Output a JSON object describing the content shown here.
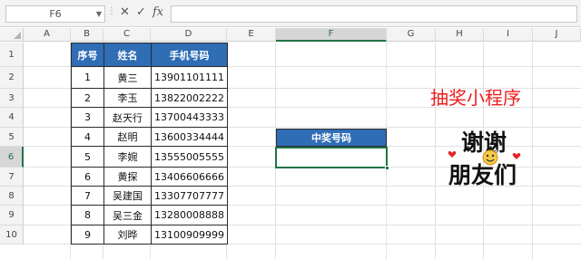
{
  "formula_bar": {
    "name_box": "F6",
    "cancel_icon": "✕",
    "confirm_icon": "✓",
    "fx_label": "fx",
    "formula": ""
  },
  "columns": [
    "A",
    "B",
    "C",
    "D",
    "E",
    "F",
    "G",
    "H",
    "I",
    "J"
  ],
  "selected_column": "F",
  "rows": [
    "1",
    "2",
    "3",
    "4",
    "5",
    "6",
    "7",
    "8",
    "9",
    "10"
  ],
  "selected_row": "6",
  "table": {
    "headers": [
      "序号",
      "姓名",
      "手机号码"
    ],
    "rows": [
      [
        "1",
        "黄三",
        "13901101111"
      ],
      [
        "2",
        "李玉",
        "13822002222"
      ],
      [
        "3",
        "赵天行",
        "13700443333"
      ],
      [
        "4",
        "赵明",
        "13600334444"
      ],
      [
        "5",
        "李婉",
        "13555005555"
      ],
      [
        "6",
        "黄探",
        "13406606666"
      ],
      [
        "7",
        "吴建国",
        "13307707777"
      ],
      [
        "8",
        "吴三金",
        "13280008888"
      ],
      [
        "9",
        "刘晔",
        "13100909999"
      ]
    ]
  },
  "prize": {
    "header": "中奖号码",
    "value": ""
  },
  "decor": {
    "title": "抽奖小程序",
    "thanks_line1": "谢谢",
    "thanks_line2": "朋友们",
    "icons": [
      "smiley-icon",
      "heart-icon"
    ]
  },
  "colors": {
    "header_blue": "#2f6db5",
    "selection_green": "#217346",
    "title_red": "#ee1c1c"
  }
}
